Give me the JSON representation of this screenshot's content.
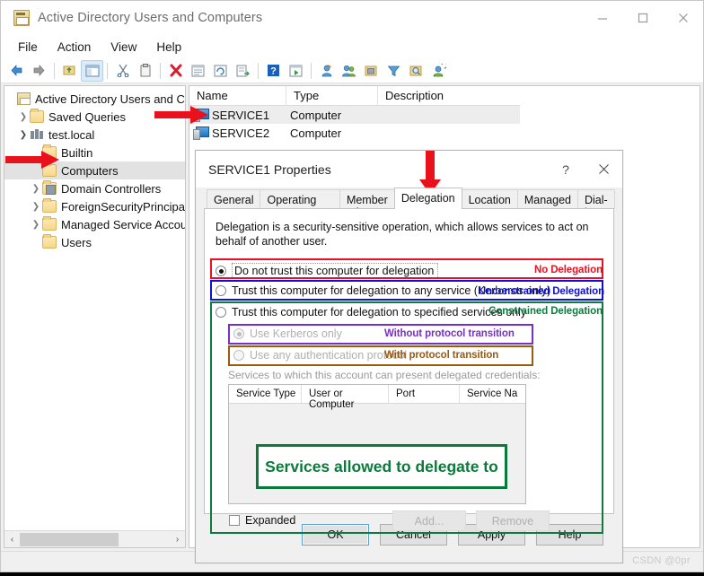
{
  "window": {
    "title": "Active Directory Users and Computers",
    "title_icon": "console-icon",
    "controls": {
      "minimize": "minimize-icon",
      "maximize": "maximize-icon",
      "close": "close-icon"
    }
  },
  "menubar": {
    "items": [
      "File",
      "Action",
      "View",
      "Help"
    ]
  },
  "toolbar": {
    "items": [
      "back-icon",
      "forward-icon",
      "up-folder-icon",
      "show-hide-tree-icon",
      "cut-icon",
      "copy-icon",
      "delete-icon",
      "properties-icon",
      "refresh-icon",
      "export-list-icon",
      "help-icon",
      "run-icon",
      "new-user-icon",
      "new-group-icon",
      "new-ou-icon",
      "filter-icon",
      "find-icon",
      "add-member-icon"
    ]
  },
  "tree": {
    "items": [
      {
        "label": "Active Directory Users and Comp",
        "icon": "console-root-icon",
        "twisty": "",
        "indent": 0,
        "selected": false
      },
      {
        "label": "Saved Queries",
        "icon": "folder-icon",
        "twisty": "collapsed",
        "indent": 1,
        "selected": false
      },
      {
        "label": "test.local",
        "icon": "domain-icon",
        "twisty": "expanded",
        "indent": 1,
        "selected": false
      },
      {
        "label": "Builtin",
        "icon": "folder-icon",
        "twisty": "",
        "indent": 2,
        "selected": false
      },
      {
        "label": "Computers",
        "icon": "folder-icon",
        "twisty": "",
        "indent": 2,
        "selected": true
      },
      {
        "label": "Domain Controllers",
        "icon": "ou-folder-icon",
        "twisty": "collapsed",
        "indent": 2,
        "selected": false
      },
      {
        "label": "ForeignSecurityPrincipals",
        "icon": "folder-icon",
        "twisty": "collapsed",
        "indent": 2,
        "selected": false
      },
      {
        "label": "Managed Service Accoun",
        "icon": "folder-icon",
        "twisty": "collapsed",
        "indent": 2,
        "selected": false
      },
      {
        "label": "Users",
        "icon": "folder-icon",
        "twisty": "",
        "indent": 2,
        "selected": false
      }
    ],
    "hscroll": {
      "left_arrow": "‹",
      "right_arrow": "›"
    }
  },
  "list": {
    "columns": [
      "Name",
      "Type",
      "Description"
    ],
    "rows": [
      {
        "name": "SERVICE1",
        "type": "Computer",
        "description": "",
        "icon": "computer-icon",
        "selected": true
      },
      {
        "name": "SERVICE2",
        "type": "Computer",
        "description": "",
        "icon": "computer-icon",
        "selected": false
      }
    ]
  },
  "dialog": {
    "title": "SERVICE1 Properties",
    "help_button": "?",
    "close_button": "✕",
    "tabs": [
      {
        "label": "General",
        "active": false
      },
      {
        "label": "Operating System",
        "active": false
      },
      {
        "label": "Member Of",
        "active": false
      },
      {
        "label": "Delegation",
        "active": true
      },
      {
        "label": "Location",
        "active": false
      },
      {
        "label": "Managed By",
        "active": false
      },
      {
        "label": "Dial-in",
        "active": false
      }
    ],
    "description": "Delegation is a security-sensitive operation, which allows services to act on behalf of another user.",
    "options": [
      {
        "label": "Do not trust this computer for delegation",
        "selected": true,
        "disabled": false,
        "focused": true
      },
      {
        "label": "Trust this computer for delegation to any service (Kerberos only)",
        "selected": false,
        "disabled": false,
        "focused": false
      },
      {
        "label": "Trust this computer for delegation to specified services only",
        "selected": false,
        "disabled": false,
        "focused": false
      }
    ],
    "sub_options": [
      {
        "label": "Use Kerberos only",
        "selected": true,
        "disabled": true
      },
      {
        "label": "Use any authentication protocol",
        "selected": false,
        "disabled": true
      }
    ],
    "services_label": "Services to which this account can present delegated credentials:",
    "services_columns": [
      "Service Type",
      "User or Computer",
      "Port",
      "Service Na"
    ],
    "services_rows": [],
    "expanded_checkbox": {
      "label": "Expanded",
      "checked": false
    },
    "list_buttons": [
      {
        "label": "Add...",
        "disabled": true
      },
      {
        "label": "Remove",
        "disabled": true
      }
    ],
    "footer_buttons": [
      {
        "label": "OK",
        "default": true
      },
      {
        "label": "Cancel",
        "default": false
      },
      {
        "label": "Apply",
        "default": false
      },
      {
        "label": "Help",
        "default": false
      }
    ]
  },
  "annotations": [
    {
      "id": "no-delegation",
      "text": "No Delegation",
      "color": "#e81123"
    },
    {
      "id": "unconstrained-delegation",
      "text": "Unconstrained Delegation",
      "color": "#1010d0"
    },
    {
      "id": "constrained-delegation",
      "text": "Constrained Delegation",
      "color": "#0f7a3d"
    },
    {
      "id": "without-protocol-transition",
      "text": "Without protocol transition",
      "color": "#7b2fbe"
    },
    {
      "id": "with-protocol-transition",
      "text": "With protocol transition",
      "color": "#9c5a10"
    },
    {
      "id": "services-allowed",
      "text": "Services allowed to delegate to",
      "color": "#0a7a3a"
    }
  ],
  "watermark": "CSDN @0pr"
}
